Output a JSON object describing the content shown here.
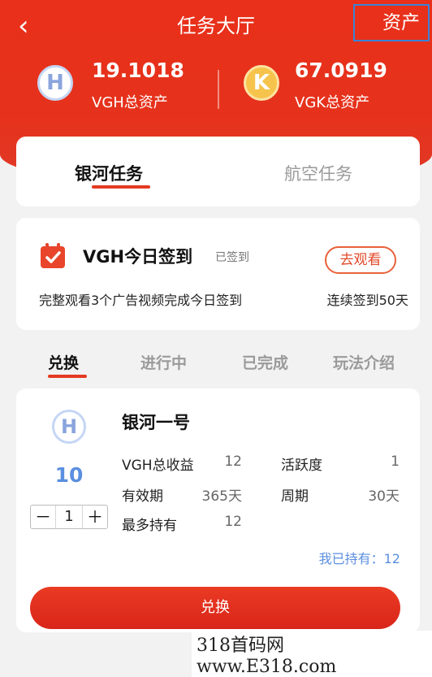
{
  "header": {
    "back_icon": "‹",
    "title": "任务大厅",
    "assets_button": "资产"
  },
  "balances": [
    {
      "icon_letter": "H",
      "value": "19.1018",
      "label": "VGH总资产"
    },
    {
      "icon_letter": "K",
      "value": "67.0919",
      "label": "VGK总资产"
    }
  ],
  "task_tabs": {
    "active": "银河任务",
    "inactive": "航空任务"
  },
  "sign_in": {
    "title": "VGH今日签到",
    "status": "已签到",
    "watch_button": "去观看",
    "description": "完整观看3个广告视频完成今日签到",
    "streak": "连续签到50天"
  },
  "sub_tabs": [
    "兑换",
    "进行中",
    "已完成",
    "玩法介绍"
  ],
  "product": {
    "icon_letter": "H",
    "name": "银河一号",
    "price": "10",
    "quantity": "1",
    "minus": "－",
    "plus": "＋",
    "fields": {
      "total_income_label": "VGH总收益",
      "total_income_value": "12",
      "activity_label": "活跃度",
      "activity_value": "1",
      "validity_label": "有效期",
      "validity_value": "365天",
      "cycle_label": "周期",
      "cycle_value": "30天",
      "max_hold_label": "最多持有",
      "max_hold_value": "12"
    },
    "holding": "我已持有：12",
    "exchange_button": "兑换"
  },
  "watermark": "318首码网  www.E318.com",
  "colors": {
    "accent": "#e53a22",
    "link_blue": "#5b8fe0",
    "gold": "#f6c34c"
  }
}
